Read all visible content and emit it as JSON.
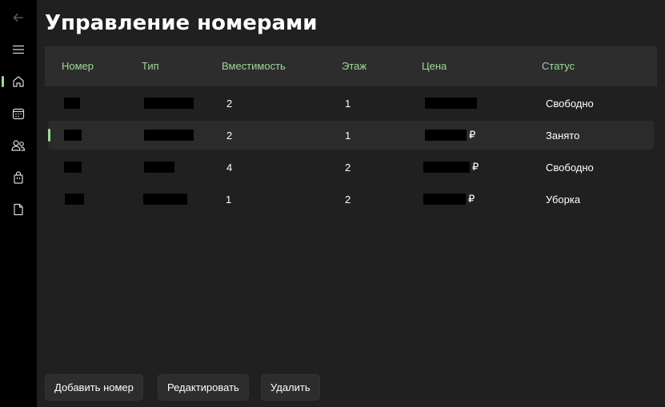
{
  "nav": {
    "items": [
      {
        "icon": "back-arrow-icon"
      },
      {
        "icon": "hamburger-menu-icon"
      },
      {
        "icon": "home-icon",
        "active": true
      },
      {
        "icon": "calendar-icon"
      },
      {
        "icon": "people-icon"
      },
      {
        "icon": "shopping-bag-icon"
      },
      {
        "icon": "document-icon"
      }
    ]
  },
  "page": {
    "title": "Управление номерами"
  },
  "table": {
    "columns": [
      "Номер",
      "Тип",
      "Вместимость",
      "Этаж",
      "Цена",
      "Статус"
    ],
    "rows": [
      {
        "number": "",
        "type": "",
        "capacity": "2",
        "floor": "1",
        "price": "",
        "price_suffix": "",
        "status": "Свободно",
        "selected": false
      },
      {
        "number": "",
        "type": "",
        "capacity": "2",
        "floor": "1",
        "price": "",
        "price_suffix": "₽",
        "status": "Занято",
        "selected": true
      },
      {
        "number": "",
        "type": "",
        "capacity": "4",
        "floor": "2",
        "price": "",
        "price_suffix": "₽",
        "status": "Свободно",
        "selected": false
      },
      {
        "number": "",
        "type": "",
        "capacity": "1",
        "floor": "2",
        "price": "",
        "price_suffix": "₽",
        "status": "Уборка",
        "selected": false
      }
    ]
  },
  "actions": {
    "add": "Добавить номер",
    "edit": "Редактировать",
    "delete": "Удалить"
  },
  "colors": {
    "accent": "#9fd89b",
    "sidebar": "#000000",
    "background": "#202020",
    "header": "#2d2d2d"
  }
}
